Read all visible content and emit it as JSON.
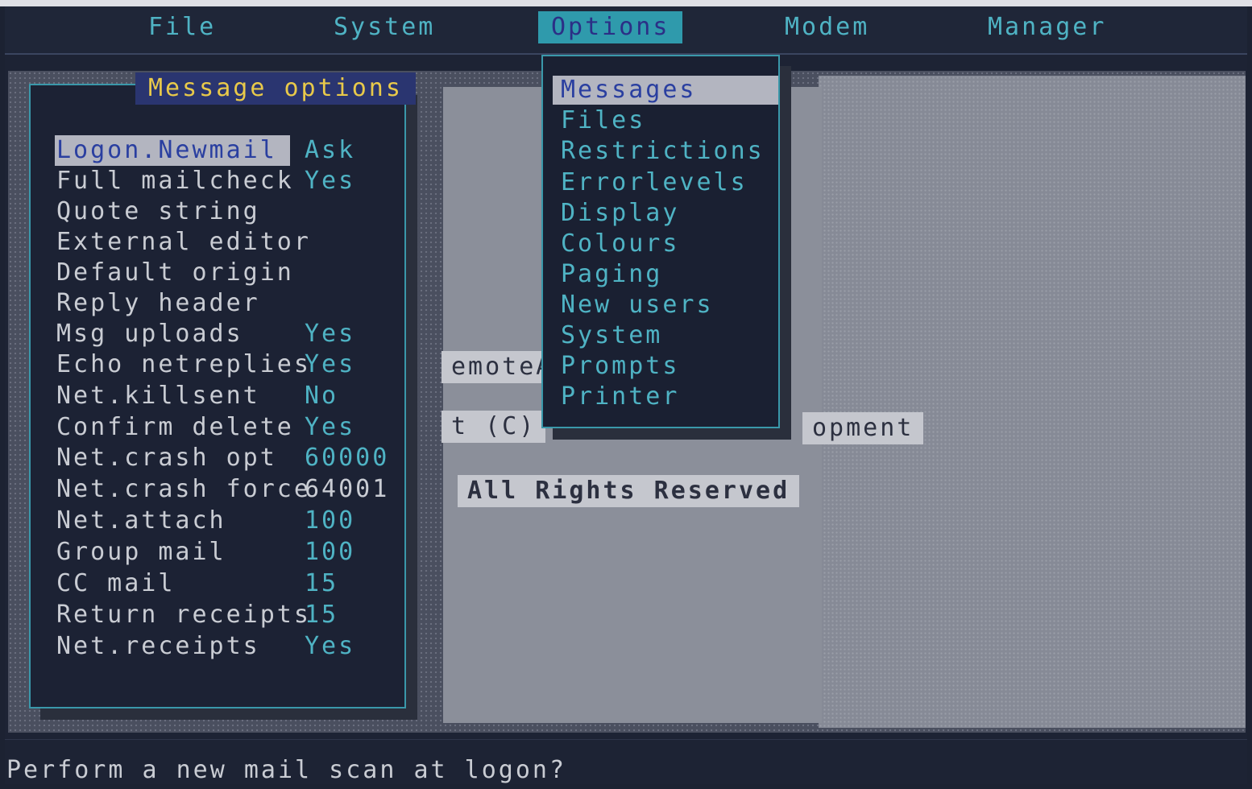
{
  "menubar": {
    "items": [
      {
        "label": "File"
      },
      {
        "label": "System"
      },
      {
        "label": "Options",
        "active": true
      },
      {
        "label": "Modem"
      },
      {
        "label": "Manager"
      }
    ]
  },
  "background": {
    "fragment_remote": "emoteA",
    "fragment_copyright": "t (C)",
    "fragment_development": "opment",
    "rights": "All Rights Reserved"
  },
  "message_options": {
    "title": "Message options",
    "options": [
      {
        "label": "Logon.Newmail",
        "value": "Ask",
        "selected": true
      },
      {
        "label": "Full mailcheck",
        "value": "Yes"
      },
      {
        "label": "Quote string",
        "value": ""
      },
      {
        "label": "External editor",
        "value": ""
      },
      {
        "label": "Default origin",
        "value": ""
      },
      {
        "label": "Reply header",
        "value": ""
      },
      {
        "label": "Msg uploads",
        "value": "Yes"
      },
      {
        "label": "Echo netreplies",
        "value": "Yes"
      },
      {
        "label": "Net.killsent",
        "value": "No"
      },
      {
        "label": "Confirm delete",
        "value": "Yes"
      },
      {
        "label": "Net.crash opt",
        "value": "60000"
      },
      {
        "label": "Net.crash force",
        "value": "64001"
      },
      {
        "label": "Net.attach",
        "value": "100"
      },
      {
        "label": "Group mail",
        "value": "100"
      },
      {
        "label": "CC mail",
        "value": "15"
      },
      {
        "label": "Return receipts",
        "value": "15"
      },
      {
        "label": "Net.receipts",
        "value": "Yes"
      }
    ]
  },
  "options_menu": {
    "items": [
      {
        "label": "Messages",
        "selected": true
      },
      {
        "label": "Files"
      },
      {
        "label": "Restrictions"
      },
      {
        "label": "Errorlevels"
      },
      {
        "label": "Display"
      },
      {
        "label": "Colours"
      },
      {
        "label": "Paging"
      },
      {
        "label": "New users"
      },
      {
        "label": "System"
      },
      {
        "label": "Prompts"
      },
      {
        "label": "Printer"
      }
    ]
  },
  "status": {
    "text": "Perform a new mail scan at logon?"
  },
  "colors": {
    "accent": "#4fb3c4",
    "title_text": "#e8c94a",
    "selection_bg": "#b3b5c0",
    "selection_text": "#2a3fa0",
    "screen_bg": "#1d2334"
  }
}
